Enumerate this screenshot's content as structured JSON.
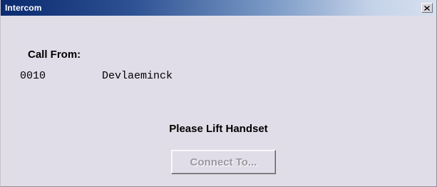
{
  "window": {
    "title": "Intercom",
    "close_icon": "close-icon"
  },
  "call": {
    "label": "Call From:",
    "number": "0010",
    "name": "Devlaeminck"
  },
  "prompt": "Please Lift Handset",
  "actions": {
    "connect_label": "Connect To...",
    "connect_enabled": false
  },
  "colors": {
    "titlebar_dark": "#0b2a6f",
    "titlebar_light": "#d6e0ef",
    "window_bg": "#e1dde8",
    "disabled_text": "#9b98a0"
  }
}
